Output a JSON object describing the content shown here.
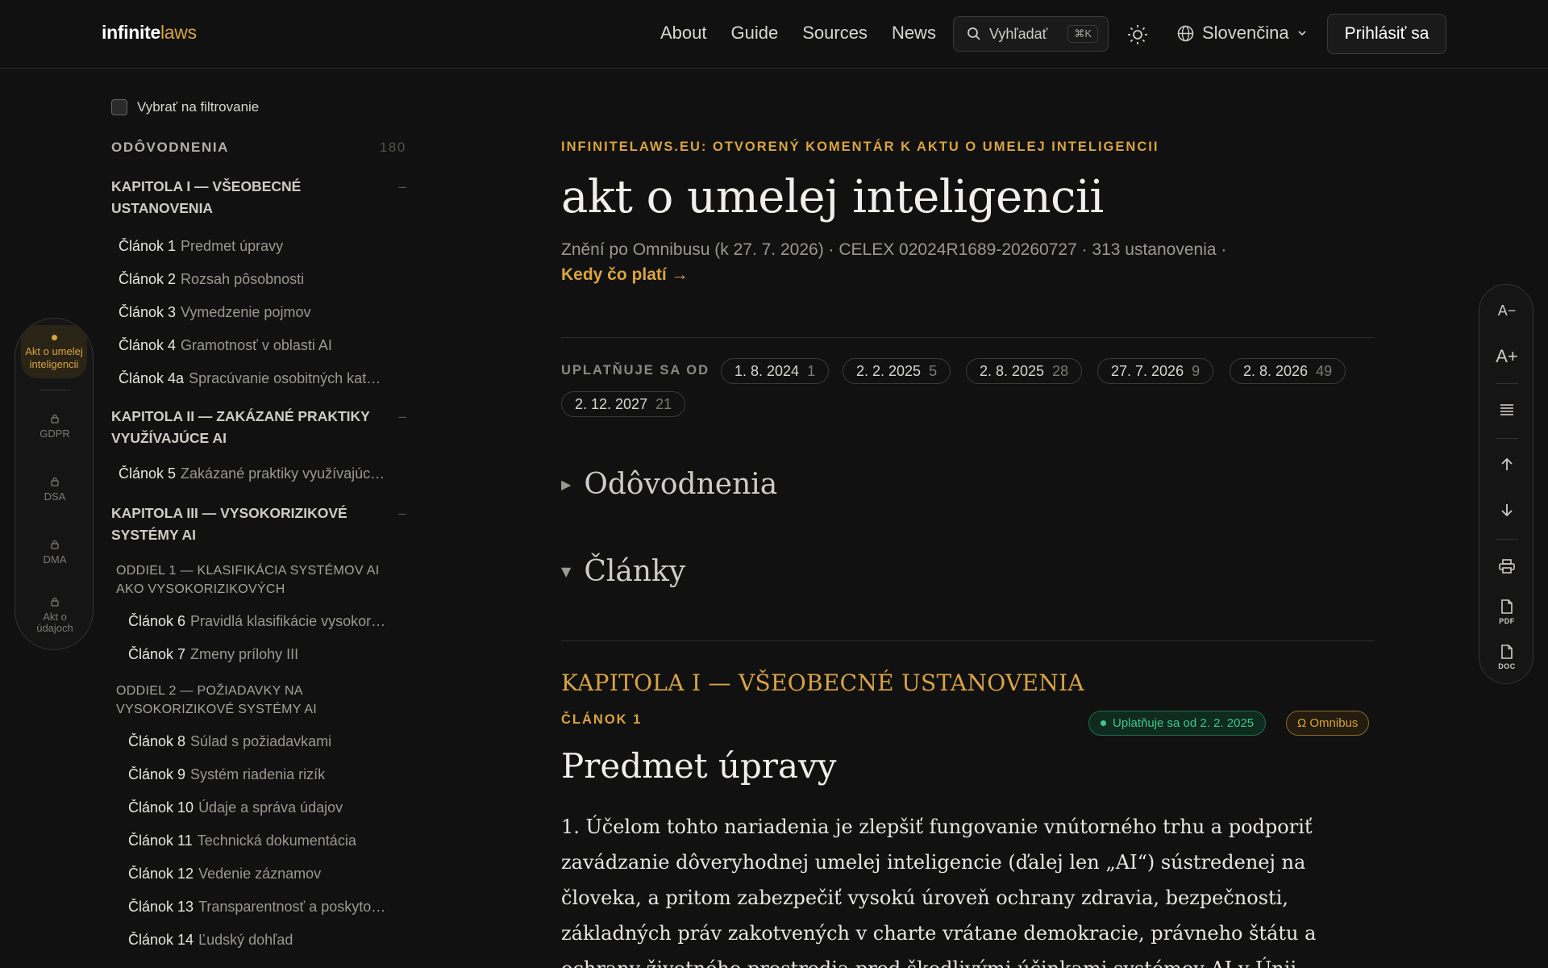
{
  "header": {
    "logo_part1": "infinite",
    "logo_part2": "laws",
    "nav": [
      "About",
      "Guide",
      "Sources",
      "News"
    ],
    "search_label": "Vyhľadať",
    "search_shortcut": "⌘K",
    "language": "Slovenčina",
    "login_label": "Prihlásiť sa"
  },
  "switcher": {
    "active": "Akt o umelej inteligencii",
    "items": [
      "GDPR",
      "DSA",
      "DMA",
      "Akt o údajoch"
    ]
  },
  "toc": {
    "filter_label": "Vybrať na filtrovanie",
    "recitals_label": "ODÔVODNENIA",
    "recitals_count": "180",
    "chapters": [
      {
        "title": "KAPITOLA I — VŠEOBECNÉ USTANOVENIA",
        "collapse": "–"
      },
      {
        "title": "KAPITOLA II — ZAKÁZANÉ PRAKTIKY VYUŽÍVAJÚCE AI",
        "collapse": "–"
      },
      {
        "title": "KAPITOLA III — VYSOKORIZIKOVÉ SYSTÉMY AI",
        "collapse": "–"
      }
    ],
    "sections": [
      "ODDIEL 1 — KLASIFIKÁCIA SYSTÉMOV AI AKO VYSOKORIZIKOVÝCH",
      "ODDIEL 2 — POŽIADAVKY NA VYSOKORIZIKOVÉ SYSTÉMY AI"
    ],
    "articles": [
      {
        "num": "Článok 1",
        "title": "Predmet úpravy"
      },
      {
        "num": "Článok 2",
        "title": "Rozsah pôsobnosti"
      },
      {
        "num": "Článok 3",
        "title": "Vymedzenie pojmov"
      },
      {
        "num": "Článok 4",
        "title": "Gramotnosť v oblasti AI"
      },
      {
        "num": "Článok 4a",
        "title": "Spracúvanie osobitných kat…"
      },
      {
        "num": "Článok 5",
        "title": "Zakázané praktiky využívajúc…"
      },
      {
        "num": "Článok 6",
        "title": "Pravidlá klasifikácie vysokor…"
      },
      {
        "num": "Článok 7",
        "title": "Zmeny prílohy III"
      },
      {
        "num": "Článok 8",
        "title": "Súlad s požiadavkami"
      },
      {
        "num": "Článok 9",
        "title": "Systém riadenia rizík"
      },
      {
        "num": "Článok 10",
        "title": "Údaje a správa údajov"
      },
      {
        "num": "Článok 11",
        "title": "Technická dokumentácia"
      },
      {
        "num": "Článok 12",
        "title": "Vedenie záznamov"
      },
      {
        "num": "Článok 13",
        "title": "Transparentnosť a poskyto…"
      },
      {
        "num": "Článok 14",
        "title": "Ľudský dohľad"
      }
    ]
  },
  "main": {
    "kicker": "INFINITELAWS.EU: OTVORENÝ KOMENTÁR K AKTU O UMELEJ INTELIGENCII",
    "title": "akt o umelej inteligencii",
    "meta": "Znění po Omnibusu (k 27. 7. 2026) · CELEX 02024R1689-20260727 · 313 ustanovenia ·",
    "meta_link": "Kedy čo platí →",
    "applies_label": "UPLATŇUJE SA OD",
    "dates": [
      {
        "date": "1. 8. 2024",
        "count": "1"
      },
      {
        "date": "2. 2. 2025",
        "count": "5"
      },
      {
        "date": "2. 8. 2025",
        "count": "28"
      },
      {
        "date": "27. 7. 2026",
        "count": "9"
      },
      {
        "date": "2. 8. 2026",
        "count": "49"
      },
      {
        "date": "2. 12. 2027",
        "count": "21"
      }
    ],
    "recitals_toggle": "Odôvodnenia",
    "articles_toggle": "Články",
    "chapter_title": "KAPITOLA I — VŠEOBECNÉ USTANOVENIA",
    "article_label": "ČLÁNOK 1",
    "badge_applies": "Uplatňuje sa od 2. 2. 2025",
    "badge_omnibus": "Ω Omnibus",
    "article_title": "Predmet úpravy",
    "paragraph": "1.  Účelom tohto nariadenia je zlepšiť fungovanie vnútorného trhu a podporiť zavádzanie dôveryhodnej umelej inteligencie (ďalej len „AI“) sústredenej na človeka, a pritom zabezpečiť vysokú úroveň ochrany zdravia, bezpečnosti, základných práv zakotvených v charte vrátane demokracie, právneho štátu a ochrany životného prostredia pred škodlivými účinkami systémov AI v Únii"
  },
  "rail": {
    "font_smaller": "A−",
    "font_larger": "A+",
    "pdf": "PDF",
    "doc": "DOC"
  }
}
